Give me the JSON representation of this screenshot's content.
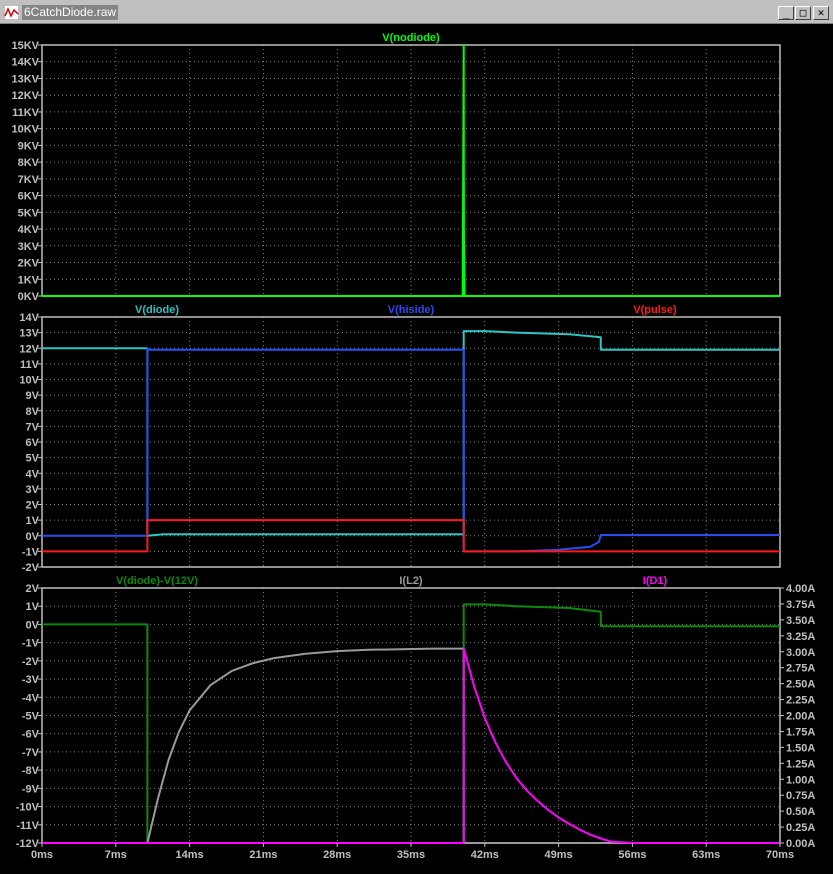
{
  "window": {
    "title": "6CatchDiode.raw",
    "buttons": {
      "minimize": "_",
      "maximize": "□",
      "close": "✕"
    },
    "icons": {
      "app": "waveform-icon"
    }
  },
  "colors": {
    "background": "#000000",
    "grid": "#808080",
    "frame": "#c0c0c0",
    "nodiode": "#00ff00",
    "diode": "#2ec4c4",
    "hiside": "#2a4cf0",
    "pulse": "#ff1a1a",
    "diode_minus_12": "#0b8a0b",
    "il2": "#9a9a9a",
    "id1": "#ff00ff"
  },
  "chart_data": [
    {
      "type": "line",
      "title": "V(nodiode)",
      "xlabel": "",
      "ylabel": "",
      "xlim": [
        0,
        70
      ],
      "ylim": [
        0,
        15000
      ],
      "grid": true,
      "x_ticks": [
        "0ms",
        "7ms",
        "14ms",
        "21ms",
        "28ms",
        "35ms",
        "42ms",
        "49ms",
        "56ms",
        "63ms",
        "70ms"
      ],
      "y_ticks": [
        "0KV",
        "1KV",
        "2KV",
        "3KV",
        "4KV",
        "5KV",
        "6KV",
        "7KV",
        "8KV",
        "9KV",
        "10KV",
        "11KV",
        "12KV",
        "13KV",
        "14KV",
        "15KV"
      ],
      "legend": [
        "V(nodiode)"
      ],
      "series": [
        {
          "name": "V(nodiode)",
          "color_key": "nodiode",
          "x": [
            0,
            39.9,
            40.0,
            40.02,
            40.08,
            40.1,
            70
          ],
          "y": [
            0,
            0,
            15000,
            3800,
            0,
            0,
            0
          ]
        }
      ]
    },
    {
      "type": "line",
      "title": "",
      "xlabel": "",
      "ylabel": "",
      "xlim": [
        0,
        70
      ],
      "ylim": [
        -2,
        14
      ],
      "grid": true,
      "y_ticks": [
        "-2V",
        "-1V",
        "0V",
        "1V",
        "2V",
        "3V",
        "4V",
        "5V",
        "6V",
        "7V",
        "8V",
        "9V",
        "10V",
        "11V",
        "12V",
        "13V",
        "14V"
      ],
      "legend": [
        "V(diode)",
        "V(hiside)",
        "V(pulse)"
      ],
      "series": [
        {
          "name": "V(diode)",
          "color_key": "diode",
          "x": [
            0,
            10,
            10,
            11.5,
            39.9,
            40,
            40,
            42,
            45,
            50,
            53,
            53,
            70
          ],
          "y": [
            12,
            12,
            0,
            0.1,
            0.1,
            0.1,
            13.1,
            13.1,
            13,
            12.9,
            12.7,
            11.9,
            11.9
          ]
        },
        {
          "name": "V(hiside)",
          "color_key": "hiside",
          "x": [
            0,
            10,
            10,
            10.2,
            39.9,
            40,
            40,
            45,
            49,
            52,
            52.8,
            53,
            53,
            70
          ],
          "y": [
            0,
            0,
            12,
            11.9,
            11.9,
            11.9,
            -1,
            -1,
            -0.9,
            -0.7,
            -0.4,
            0,
            0.05,
            0.05
          ]
        },
        {
          "name": "V(pulse)",
          "color_key": "pulse",
          "x": [
            0,
            10,
            10,
            40,
            40,
            70
          ],
          "y": [
            -1,
            -1,
            1,
            1,
            -1,
            -1
          ]
        }
      ]
    },
    {
      "type": "line",
      "title": "",
      "xlabel": "",
      "ylabel": "",
      "xlim": [
        0,
        70
      ],
      "ylim": [
        -12,
        2
      ],
      "y2lim": [
        0,
        4
      ],
      "grid": true,
      "y_ticks": [
        "-12V",
        "-11V",
        "-10V",
        "-9V",
        "-8V",
        "-7V",
        "-6V",
        "-5V",
        "-4V",
        "-3V",
        "-2V",
        "-1V",
        "0V",
        "1V",
        "2V"
      ],
      "y2_ticks": [
        "0.00A",
        "0.25A",
        "0.50A",
        "0.75A",
        "1.00A",
        "1.25A",
        "1.50A",
        "1.75A",
        "2.00A",
        "2.25A",
        "2.50A",
        "2.75A",
        "3.00A",
        "3.25A",
        "3.50A",
        "3.75A",
        "4.00A"
      ],
      "legend": [
        "V(diode)-V(12V)",
        "I(L2)",
        "I(D1)"
      ],
      "series": [
        {
          "name": "V(diode)-V(12V)",
          "color_key": "diode_minus_12",
          "axis": "left",
          "x": [
            0,
            10,
            10,
            40,
            40,
            42,
            45,
            50,
            53,
            53,
            70
          ],
          "y": [
            0,
            0,
            -12,
            -12,
            1.1,
            1.1,
            1,
            0.9,
            0.7,
            -0.1,
            -0.1
          ]
        },
        {
          "name": "I(L2)",
          "color_key": "il2",
          "axis": "right",
          "x": [
            0,
            10,
            11,
            12,
            13,
            14,
            16,
            18,
            20,
            22,
            25,
            28,
            31,
            34,
            37,
            40,
            40,
            70
          ],
          "y": [
            0,
            0,
            0.7,
            1.3,
            1.75,
            2.08,
            2.48,
            2.7,
            2.82,
            2.9,
            2.97,
            3.01,
            3.03,
            3.04,
            3.05,
            3.05,
            0,
            0
          ]
        },
        {
          "name": "I(D1)",
          "color_key": "id1",
          "axis": "right",
          "x": [
            0,
            40,
            40,
            41,
            42,
            43,
            44,
            45,
            46,
            47,
            48,
            49,
            50,
            51,
            52,
            53,
            54,
            56,
            70
          ],
          "y": [
            0,
            0,
            3.05,
            2.45,
            1.96,
            1.58,
            1.27,
            1.02,
            0.82,
            0.66,
            0.52,
            0.4,
            0.3,
            0.21,
            0.13,
            0.07,
            0.02,
            0,
            0
          ]
        }
      ]
    }
  ]
}
